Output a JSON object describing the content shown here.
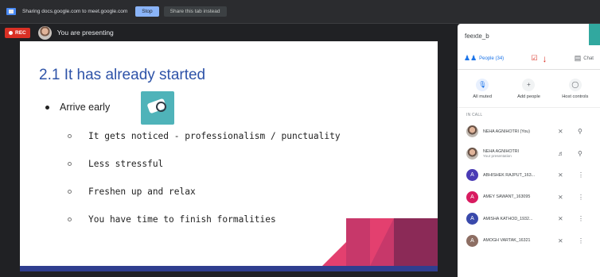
{
  "share_bar": {
    "text": "Sharing docs.google.com to meet.google.com",
    "stop_label": "Stop",
    "hide_label": "Share this tab instead"
  },
  "present_bar": {
    "rec_label": "REC",
    "presenting_text": "You are presenting"
  },
  "slide": {
    "title": "2.1 It has already started",
    "main_bullet": "Arrive early",
    "sub_bullets": [
      "It gets noticed - professionalism / punctuality",
      "Less stressful",
      "Freshen up and relax",
      "You have time to finish formalities"
    ]
  },
  "panel": {
    "meeting_name": "feexte_b",
    "tabs": {
      "people": "People (34)",
      "chat": "Chat"
    },
    "actions": [
      {
        "label": "All muted",
        "icon": "mic-off-icon"
      },
      {
        "label": "Add people",
        "icon": "add-person-icon"
      },
      {
        "label": "Host controls",
        "icon": "toggle-icon"
      }
    ],
    "section_label": "IN CALL",
    "people": [
      {
        "name": "NEHA AGNIHOTRI (You)",
        "sub": "",
        "initial": "",
        "color": "",
        "photo": true
      },
      {
        "name": "NEHA AGNIHOTRI",
        "sub": "Your presentation",
        "initial": "",
        "color": "",
        "photo": true
      },
      {
        "name": "ABHISHEK RAJPUT_163...",
        "sub": "",
        "initial": "A",
        "color": "#4a3bb5",
        "photo": false
      },
      {
        "name": "AMEY SAWANT_163095",
        "sub": "",
        "initial": "A",
        "color": "#d81b60",
        "photo": false
      },
      {
        "name": "AMISHA KATHOD_1932...",
        "sub": "",
        "initial": "A",
        "color": "#3949ab",
        "photo": false
      },
      {
        "name": "AMOGH VARTAK_16321",
        "sub": "",
        "initial": "A",
        "color": "#8d6e63",
        "photo": false
      }
    ]
  }
}
